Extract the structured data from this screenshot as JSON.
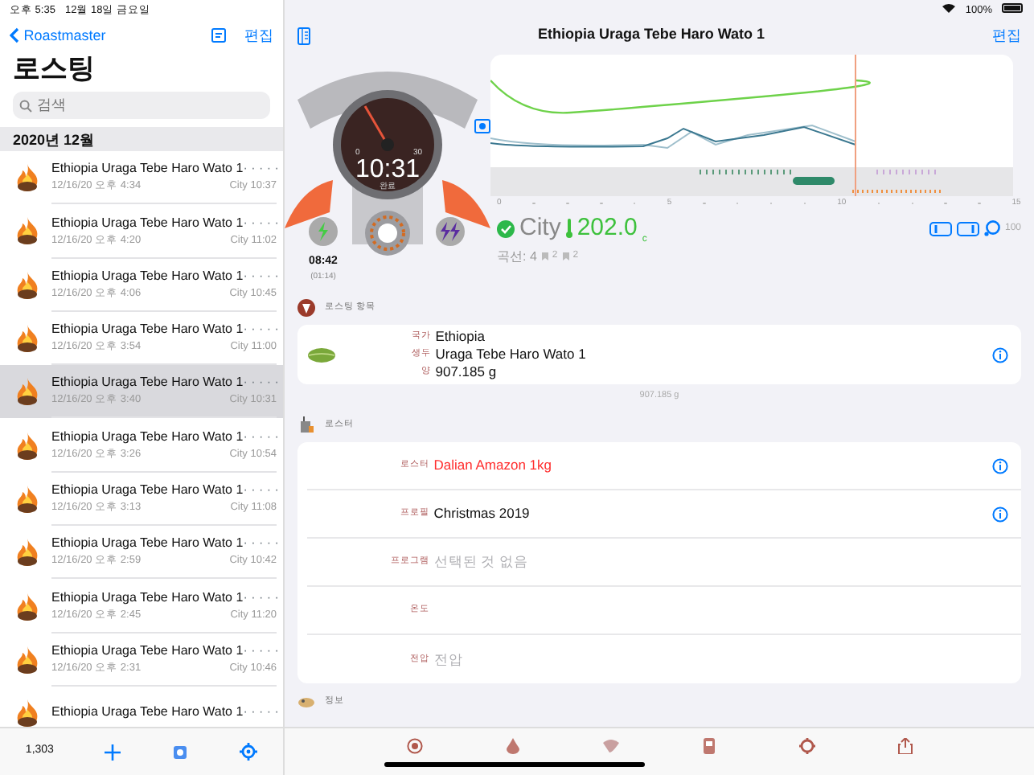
{
  "status_bar": {
    "time": "오후 5:35",
    "date": "12월 18일 금요일",
    "battery": "100%"
  },
  "sidebar": {
    "back_label": "Roastmaster",
    "edit_label": "편집",
    "title": "로스팅",
    "search": {
      "placeholder": "검색"
    },
    "section": "2020년 12월",
    "rows": [
      {
        "title": "Ethiopia Uraga Tebe Haro Wato 1",
        "rating": "· · · · ·",
        "date": "12/16/20 오후 4:34",
        "result": "City 10:37",
        "selected": false
      },
      {
        "title": "Ethiopia Uraga Tebe Haro Wato 1",
        "rating": "· · · · ·",
        "date": "12/16/20 오후 4:20",
        "result": "City 11:02",
        "selected": false
      },
      {
        "title": "Ethiopia Uraga Tebe Haro Wato 1",
        "rating": "· · · · ·",
        "date": "12/16/20 오후 4:06",
        "result": "City 10:45",
        "selected": false
      },
      {
        "title": "Ethiopia Uraga Tebe Haro Wato 1",
        "rating": "· · · · ·",
        "date": "12/16/20 오후 3:54",
        "result": "City 11:00",
        "selected": false
      },
      {
        "title": "Ethiopia Uraga Tebe Haro Wato 1",
        "rating": "· · · · ·",
        "date": "12/16/20 오후 3:40",
        "result": "City 10:31",
        "selected": true
      },
      {
        "title": "Ethiopia Uraga Tebe Haro Wato 1",
        "rating": "· · · · ·",
        "date": "12/16/20 오후 3:26",
        "result": "City 10:54",
        "selected": false
      },
      {
        "title": "Ethiopia Uraga Tebe Haro Wato 1",
        "rating": "· · · · ·",
        "date": "12/16/20 오후 3:13",
        "result": "City 11:08",
        "selected": false
      },
      {
        "title": "Ethiopia Uraga Tebe Haro Wato 1",
        "rating": "· · · · ·",
        "date": "12/16/20 오후 2:59",
        "result": "City 10:42",
        "selected": false
      },
      {
        "title": "Ethiopia Uraga Tebe Haro Wato 1",
        "rating": "· · · · ·",
        "date": "12/16/20 오후 2:45",
        "result": "City 11:20",
        "selected": false
      },
      {
        "title": "Ethiopia Uraga Tebe Haro Wato 1",
        "rating": "· · · · ·",
        "date": "12/16/20 오후 2:31",
        "result": "City 10:46",
        "selected": false
      },
      {
        "title": "Ethiopia Uraga Tebe Haro Wato 1",
        "rating": "· · · · ·",
        "selected": false
      }
    ],
    "count": "1,303"
  },
  "detail": {
    "title": "Ethiopia Uraga Tebe Haro Wato 1",
    "edit_label": "편집",
    "gauge": {
      "time": "10:31",
      "caption": "완료",
      "scale_min": "0",
      "scale_max": "30",
      "elapsed": "08:42",
      "elapsed_sub": "(01:14)"
    },
    "chart": {
      "axis_labels": [
        "0",
        "5",
        "10",
        "15"
      ]
    },
    "result": {
      "level": "City",
      "temperature": "202.0",
      "unit": "c",
      "curves": "곡선: 4",
      "marks": [
        "2",
        "2"
      ],
      "zoom": "100"
    },
    "sections": [
      {
        "kind": "bean",
        "title": "로스팅 항목",
        "fields": [
          {
            "label": "국가",
            "value": "Ethiopia"
          },
          {
            "label": "생두",
            "value": "Uraga Tebe Haro Wato 1"
          },
          {
            "label": "양",
            "value": "907.185 g"
          }
        ],
        "info": true,
        "footer": "907.185 g"
      },
      {
        "kind": "roaster",
        "title": "로스터",
        "rows": [
          {
            "label": "로스터",
            "value": "Dalian Amazon 1kg",
            "alert": true,
            "info": true
          },
          {
            "label": "프로필",
            "value": "Christmas 2019",
            "alert": false,
            "info": true
          },
          {
            "label": "프로그램",
            "placeholder": "선택된 것 없음",
            "info": false
          },
          {
            "label": "온도",
            "info": false
          },
          {
            "label": "전압",
            "placeholder": "전압",
            "info": false
          }
        ]
      },
      {
        "kind": "info",
        "title": "정보"
      }
    ]
  }
}
